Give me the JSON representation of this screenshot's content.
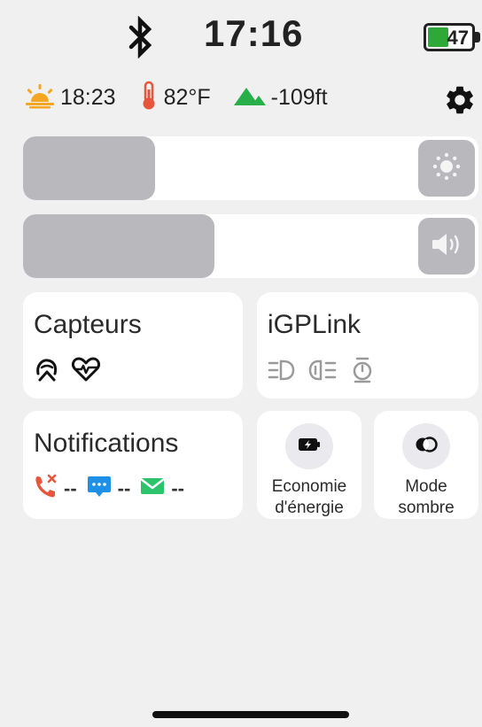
{
  "status_bar": {
    "time": "17:16",
    "battery_level": "47",
    "battery_fraction": 0.47,
    "bluetooth_icon": "bluetooth-icon"
  },
  "info_row": {
    "sunset": {
      "icon": "sunset-icon",
      "value": "18:23"
    },
    "temperature": {
      "icon": "thermometer-icon",
      "value": "82°F"
    },
    "altitude": {
      "icon": "mountain-icon",
      "value": "-109ft"
    },
    "settings_icon": "gear-icon"
  },
  "sliders": {
    "brightness": {
      "level": 0.29,
      "icon": "sun-icon"
    },
    "volume": {
      "level": 0.42,
      "icon": "speaker-icon"
    }
  },
  "cards": {
    "capteurs": {
      "title": "Capteurs",
      "icons": [
        "helmet-sensor-icon",
        "heart-rate-icon"
      ]
    },
    "igplink": {
      "title": "iGPLink",
      "icons": [
        "headlight-icon",
        "taillight-icon",
        "timer-icon"
      ]
    },
    "notifications": {
      "title": "Notifications",
      "items": [
        {
          "icon": "missed-call-icon",
          "value": "--"
        },
        {
          "icon": "message-icon",
          "value": "--"
        },
        {
          "icon": "mail-icon",
          "value": "--"
        }
      ]
    },
    "power_saving": {
      "label_line1": "Economie",
      "label_line2": "d'énergie",
      "icon": "battery-saver-icon"
    },
    "dark_mode": {
      "label_line1": "Mode",
      "label_line2": "sombre",
      "icon": "dark-mode-icon"
    }
  },
  "colors": {
    "background": "#f0f0f0",
    "card": "#ffffff",
    "slider_fill": "#b8b8bd",
    "battery_green": "#2ea836",
    "sunset_orange": "#f5a623",
    "thermo_red": "#e8553d",
    "mountain_green": "#27b04a",
    "call_red": "#e8553d",
    "message_blue": "#1e90e8",
    "mail_green": "#2cc46a"
  }
}
